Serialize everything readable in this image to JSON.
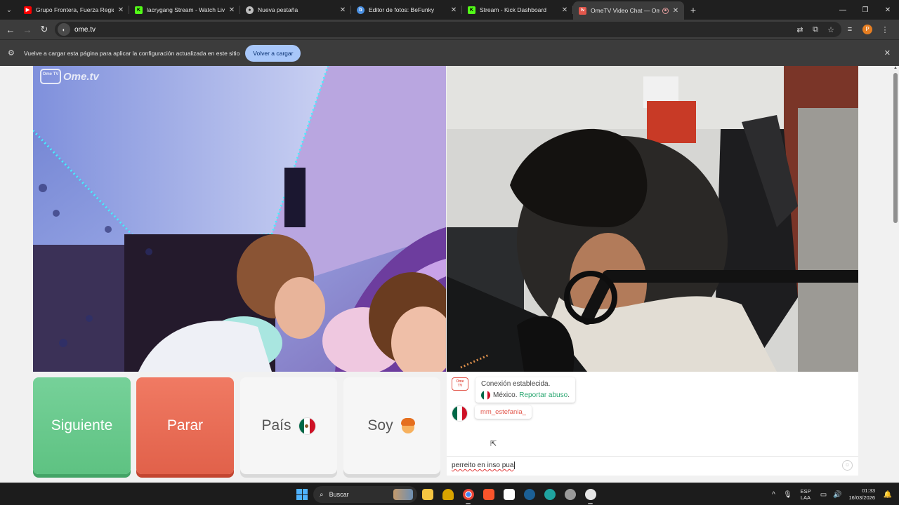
{
  "browser": {
    "tabs": [
      {
        "title": "Grupo Frontera, Fuerza Regida",
        "favicon": "youtube-icon",
        "color": "#ff0000",
        "active": false
      },
      {
        "title": "lacrygang Stream - Watch Live",
        "favicon": "kick-icon",
        "color": "#53fc18",
        "active": false
      },
      {
        "title": "Nueva pestaña",
        "favicon": "chrome-icon",
        "color": "#bdbdbd",
        "active": false
      },
      {
        "title": "Editor de fotos: BeFunky",
        "favicon": "befunky-icon",
        "color": "#4a90e2",
        "active": false
      },
      {
        "title": "Stream - Kick Dashboard",
        "favicon": "kick-icon",
        "color": "#53fc18",
        "active": false
      },
      {
        "title": "OmeTV Video Chat — Ome",
        "favicon": "ometv-icon",
        "color": "#e2574c",
        "active": true
      }
    ],
    "url": "ome.tv",
    "profile_initial": "P",
    "infobar": {
      "message": "Vuelve a cargar esta página para aplicar la configuración actualizada en este sitio",
      "button": "Volver a cargar"
    }
  },
  "ometv": {
    "logo_badge": "Ome TV",
    "logo_text": "Ome.tv",
    "buttons": {
      "next": "Siguiente",
      "stop": "Parar",
      "country": "País",
      "gender": "Soy"
    },
    "chat": {
      "system_message": "Conexión establecida.",
      "country": "México",
      "report": "Reportar abuso",
      "username": "mm_estefania_",
      "input_value": "perreito en inso pua"
    },
    "colors": {
      "next": "#5ec282",
      "stop": "#e1614a",
      "accent": "#e2574c",
      "link": "#2aa771"
    }
  },
  "taskbar": {
    "search_label": "Buscar",
    "language": "ESP",
    "layout": "LAA",
    "time": "01:33",
    "date": "16/03/2026"
  }
}
